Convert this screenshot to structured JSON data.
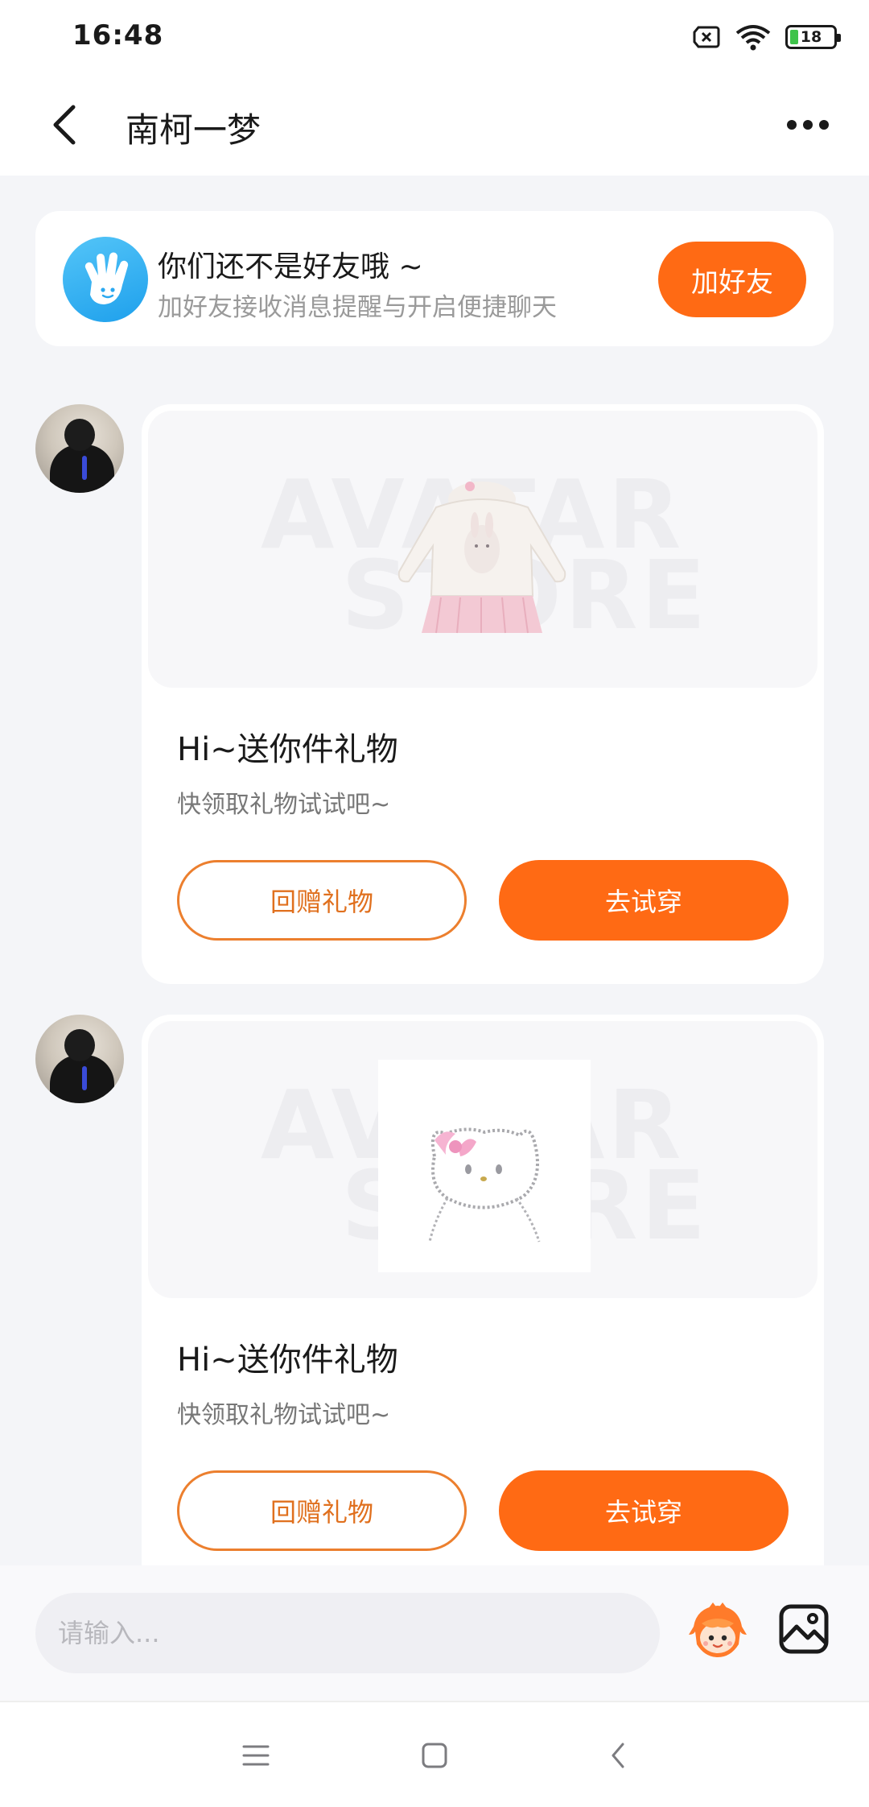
{
  "status_bar": {
    "time": "16:48",
    "battery": "18",
    "icons": [
      "sim-x-icon",
      "wifi-icon",
      "battery-icon"
    ]
  },
  "header": {
    "title": "南柯一梦",
    "back_icon": "chevron-left-icon",
    "more_icon": "more-dots-icon"
  },
  "friend_banner": {
    "title": "你们还不是好友哦 ~",
    "subtitle": "加好友接收消息提醒与开启便捷聊天",
    "button": "加好友",
    "icon": "hand-wave-icon"
  },
  "messages": [
    {
      "watermark_top": "AVATAR",
      "watermark_bottom": "STORE",
      "image": "sweater-skirt-outfit",
      "title": "Hi~送你件礼物",
      "subtitle": "快领取礼物试试吧~",
      "return_gift": "回赠礼物",
      "try_on": "去试穿"
    },
    {
      "watermark_top": "AVATAR",
      "watermark_bottom": "STORE",
      "image": "hello-kitty-necklace",
      "title": "Hi~送你件礼物",
      "subtitle": "快领取礼物试试吧~",
      "return_gift": "回赠礼物",
      "try_on": "去试穿"
    }
  ],
  "input_bar": {
    "placeholder": "请输入...",
    "emoji_icon": "emoji-mascot-icon",
    "image_icon": "image-icon"
  },
  "nav_bar": {
    "icons": [
      "menu-icon",
      "home-square-icon",
      "back-arrow-icon"
    ]
  },
  "colors": {
    "accent": "#ff6a14",
    "banner_icon": "#2aa8f0",
    "background": "#f4f5f8"
  }
}
